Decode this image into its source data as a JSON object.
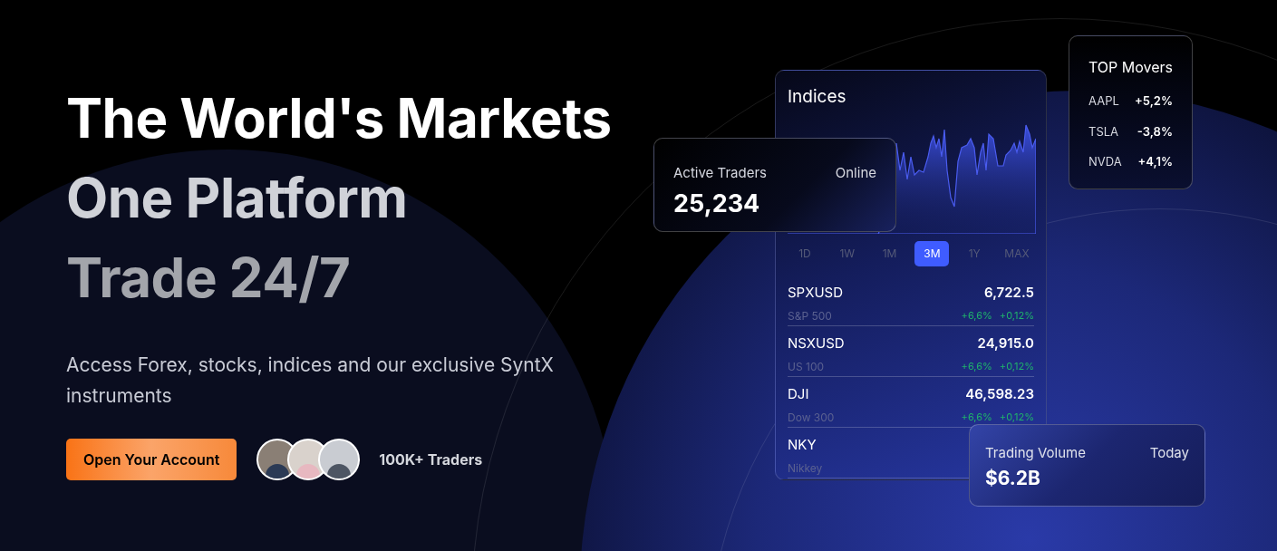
{
  "hero": {
    "headline": [
      "The World's Markets",
      "One Platform",
      "Trade 24/7"
    ],
    "subtitle": "Access Forex, stocks, indices and our exclusive SyntX instruments",
    "cta": "Open Your Account",
    "traders_label": "100K+ Traders"
  },
  "indices_card": {
    "title": "Indices",
    "ranges": [
      {
        "label": "1D",
        "selected": false
      },
      {
        "label": "1W",
        "selected": false
      },
      {
        "label": "1M",
        "selected": false
      },
      {
        "label": "3M",
        "selected": true
      },
      {
        "label": "1Y",
        "selected": false
      },
      {
        "label": "MAX",
        "selected": false
      }
    ],
    "rows": [
      {
        "symbol": "SPXUSD",
        "name": "S&P 500",
        "price": "6,722.5",
        "change": "+6,6%",
        "change_2": "+0,12%"
      },
      {
        "symbol": "NSXUSD",
        "name": "US 100",
        "price": "24,915.0",
        "change": "+6,6%",
        "change_2": "+0,12%"
      },
      {
        "symbol": "DJI",
        "name": "Dow 300",
        "price": "46,598.23",
        "change": "+6,6%",
        "change_2": "+0,12%"
      },
      {
        "symbol": "NKY",
        "name": "Nikkey"
      }
    ]
  },
  "active_traders": {
    "label": "Active Traders",
    "status": "Online",
    "value": "25,234"
  },
  "top_movers": {
    "title": "TOP Movers",
    "items": [
      {
        "symbol": "AAPL",
        "change": "+5,2%"
      },
      {
        "symbol": "TSLA",
        "change": "-3,8%"
      },
      {
        "symbol": "NVDA",
        "change": "+4,1%"
      }
    ]
  },
  "trading_volume": {
    "label": "Trading Volume",
    "period": "Today",
    "value": "$6.2B"
  }
}
